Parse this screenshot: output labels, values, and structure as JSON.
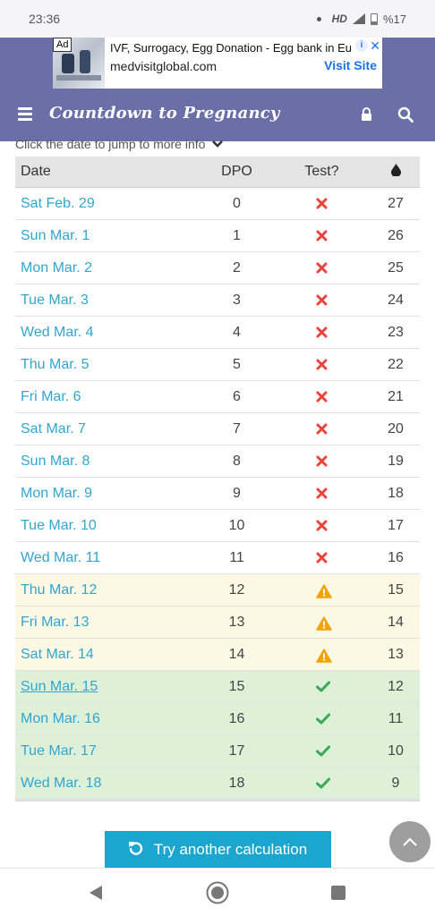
{
  "status": {
    "time": "23:36",
    "network": "HD",
    "battery": "%17"
  },
  "ad": {
    "badge": "Ad",
    "title": "IVF, Surrogacy, Egg Donation - Egg bank in Eu",
    "url": "medvisitglobal.com",
    "cta": "Visit Site",
    "info": "i",
    "close": "✕"
  },
  "header": {
    "brand": "Countdown to Pregnancy",
    "menu_icon": "hamburger-icon",
    "lock_icon": "lock-icon",
    "search_icon": "search-icon"
  },
  "hint": {
    "text": "Click the date to jump to more info",
    "chevron": "❯"
  },
  "table": {
    "columns": [
      "Date",
      "DPO",
      "Test?",
      "drop-icon"
    ],
    "rows": [
      {
        "date": "Sat Feb. 29",
        "dpo": "0",
        "test": "no",
        "left": "27"
      },
      {
        "date": "Sun Mar. 1",
        "dpo": "1",
        "test": "no",
        "left": "26"
      },
      {
        "date": "Mon Mar. 2",
        "dpo": "2",
        "test": "no",
        "left": "25"
      },
      {
        "date": "Tue Mar. 3",
        "dpo": "3",
        "test": "no",
        "left": "24"
      },
      {
        "date": "Wed Mar. 4",
        "dpo": "4",
        "test": "no",
        "left": "23"
      },
      {
        "date": "Thu Mar. 5",
        "dpo": "5",
        "test": "no",
        "left": "22"
      },
      {
        "date": "Fri Mar. 6",
        "dpo": "6",
        "test": "no",
        "left": "21"
      },
      {
        "date": "Sat Mar. 7",
        "dpo": "7",
        "test": "no",
        "left": "20"
      },
      {
        "date": "Sun Mar. 8",
        "dpo": "8",
        "test": "no",
        "left": "19"
      },
      {
        "date": "Mon Mar. 9",
        "dpo": "9",
        "test": "no",
        "left": "18"
      },
      {
        "date": "Tue Mar. 10",
        "dpo": "10",
        "test": "no",
        "left": "17"
      },
      {
        "date": "Wed Mar. 11",
        "dpo": "11",
        "test": "no",
        "left": "16"
      },
      {
        "date": "Thu Mar. 12",
        "dpo": "12",
        "test": "maybe",
        "left": "15"
      },
      {
        "date": "Fri Mar. 13",
        "dpo": "13",
        "test": "maybe",
        "left": "14"
      },
      {
        "date": "Sat Mar. 14",
        "dpo": "14",
        "test": "maybe",
        "left": "13"
      },
      {
        "date": "Sun Mar. 15",
        "dpo": "15",
        "test": "yes",
        "left": "12",
        "current": true
      },
      {
        "date": "Mon Mar. 16",
        "dpo": "16",
        "test": "yes",
        "left": "11"
      },
      {
        "date": "Tue Mar. 17",
        "dpo": "17",
        "test": "yes",
        "left": "10"
      },
      {
        "date": "Wed Mar. 18",
        "dpo": "18",
        "test": "yes",
        "left": "9"
      }
    ]
  },
  "actions": {
    "retry": "Try another calculation",
    "retry_icon": "refresh-icon",
    "scroll_top_icon": "chevron-up-icon"
  },
  "colors": {
    "header": "#6a6fa8",
    "link": "#31a6d1",
    "no": "#e8453c",
    "maybe": "#f0a30a",
    "yes": "#3aa657",
    "warn_row": "#fcf8e3",
    "ok_row": "#dff0d8",
    "button": "#1aa6cf"
  }
}
